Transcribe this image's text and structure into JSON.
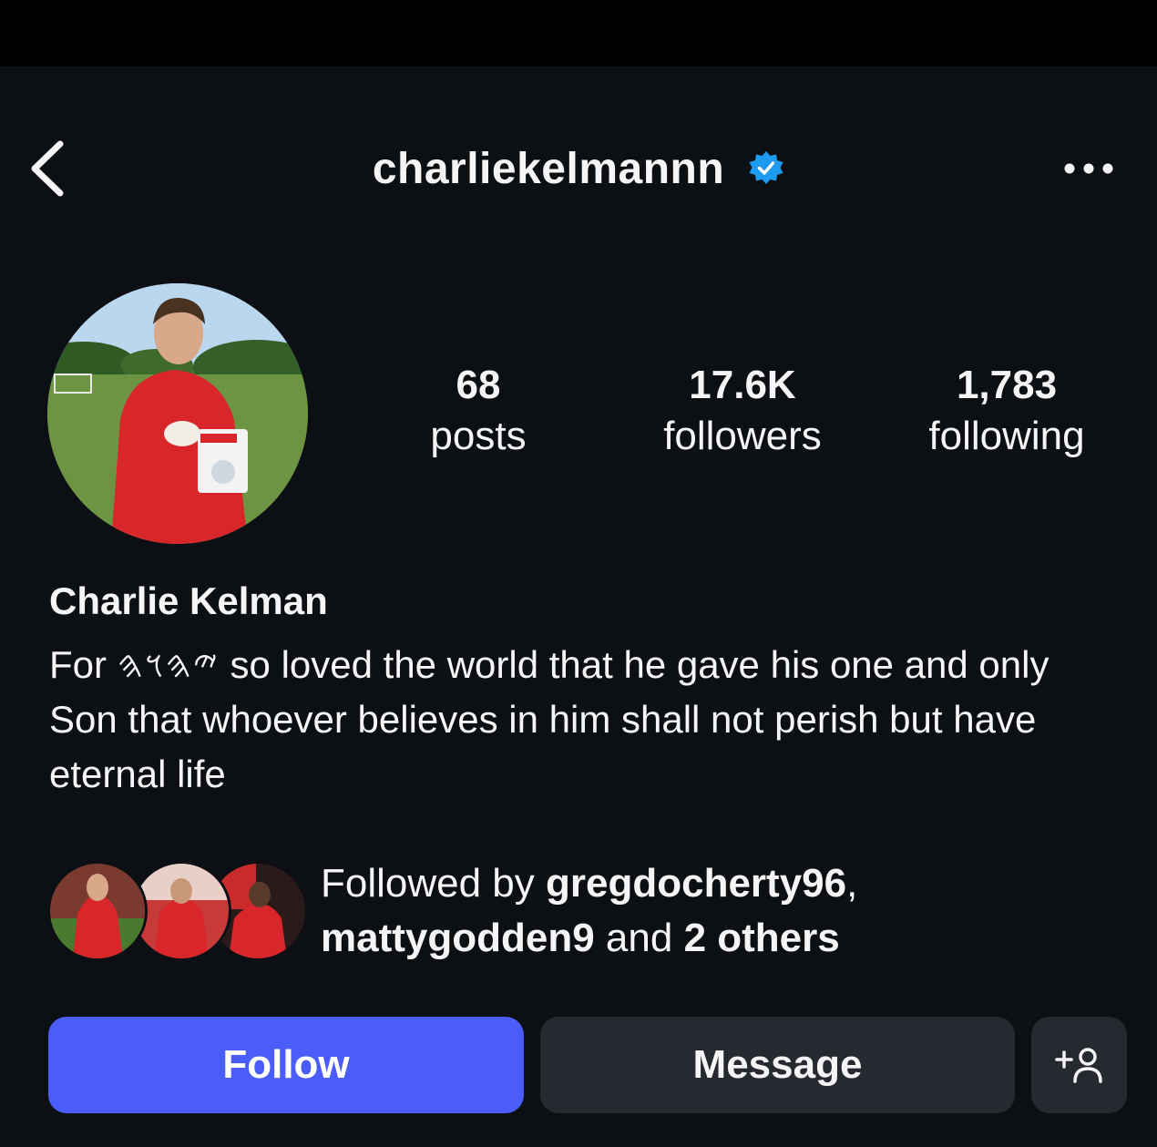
{
  "header": {
    "username": "charliekelmannn",
    "verified": true,
    "accent_verified": "#1d9bf0"
  },
  "stats": [
    {
      "value": "68",
      "label": "posts"
    },
    {
      "value": "17.6K",
      "label": "followers"
    },
    {
      "value": "1,783",
      "label": "following"
    }
  ],
  "profile": {
    "name": "Charlie Kelman",
    "bio_prefix": "For ",
    "bio_glyph": "𐤉𐤄𐤅𐤄",
    "bio_rest": " so loved the world that he gave his one and only Son that whoever believes in him shall not perish but have eternal life"
  },
  "followed_by": {
    "prefix": "Followed by ",
    "user1": "gregdocherty96",
    "sep": ",",
    "user2": "mattygodden9",
    "and": " and ",
    "others": "2 others"
  },
  "actions": {
    "follow_label": "Follow",
    "message_label": "Message",
    "add_icon": "add-person-icon"
  },
  "colors": {
    "background": "#0c1014",
    "follow_button": "#4a5df9",
    "secondary_button": "#262a30"
  }
}
